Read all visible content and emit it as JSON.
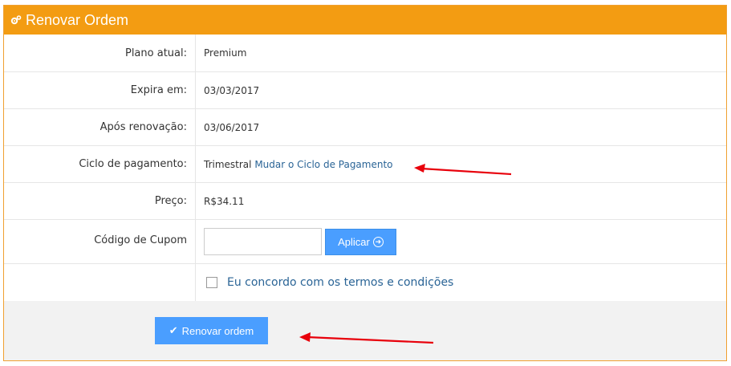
{
  "panel": {
    "title": "Renovar Ordem",
    "icon": "cogs-icon",
    "header_color": "#f39c12"
  },
  "rows": {
    "plan": {
      "label": "Plano atual:",
      "value": "Premium"
    },
    "expires": {
      "label": "Expira em:",
      "value": "03/03/2017"
    },
    "after_renewal": {
      "label": "Após renovação:",
      "value": "03/06/2017"
    },
    "billing_cycle": {
      "label": "Ciclo de pagamento:",
      "value": "Trimestral",
      "change_link": "Mudar o Ciclo de Pagamento"
    },
    "price": {
      "label": "Preço:",
      "value": "R$34.11"
    },
    "coupon": {
      "label": "Código de Cupom",
      "input_value": "",
      "apply_label": "Aplicar"
    }
  },
  "terms": {
    "label": "Eu concordo com os termos e condições",
    "checked": false
  },
  "footer": {
    "renew_label": "Renovar ordem"
  },
  "colors": {
    "accent": "#4a9eff",
    "link": "#2a6496",
    "annotation": "#e8000b"
  }
}
